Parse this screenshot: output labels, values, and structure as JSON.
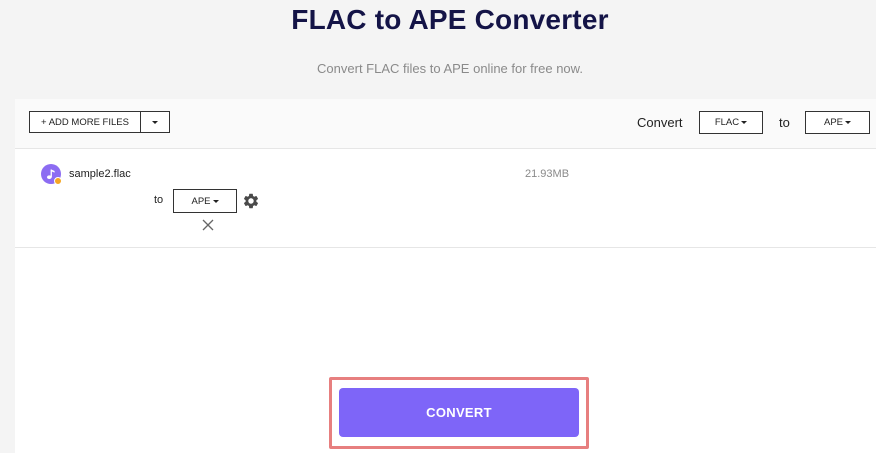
{
  "header": {
    "title": "FLAC to APE Converter",
    "subtitle": "Convert FLAC files to APE online for free now."
  },
  "toolbar": {
    "add_files_label": "+ ADD MORE FILES",
    "convert_label": "Convert",
    "from_format": "FLAC",
    "to_label": "to",
    "to_format": "APE"
  },
  "files": [
    {
      "name": "sample2.flac",
      "size": "21.93MB",
      "to_label": "to",
      "target_format": "APE"
    }
  ],
  "actions": {
    "convert_button": "CONVERT"
  },
  "icons": {
    "file": "music-note-icon",
    "settings": "gear-icon",
    "remove": "close-icon",
    "dropdown": "caret-down-icon"
  },
  "colors": {
    "title": "#141447",
    "accent": "#7e65f8",
    "file_icon": "#8c6cf2",
    "highlight": "#e77f7f"
  }
}
